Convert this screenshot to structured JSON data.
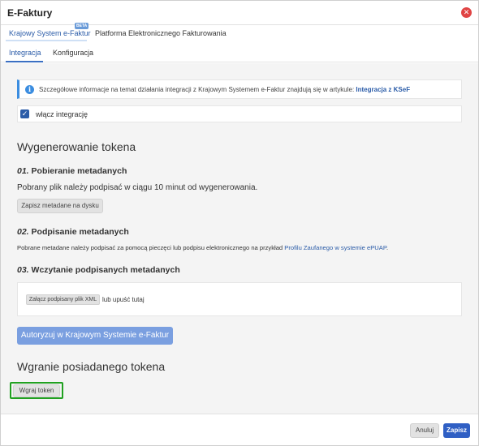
{
  "window": {
    "title": "E-Faktury",
    "close_icon": "close-icon"
  },
  "tabs_primary": [
    {
      "label": "Krajowy System e-Faktur",
      "badge": "BETA",
      "active": true
    },
    {
      "label": "Platforma Elektronicznego Fakturowania",
      "active": false
    }
  ],
  "tabs_secondary": [
    {
      "label": "Integracja",
      "active": true
    },
    {
      "label": "Konfiguracja",
      "active": false
    }
  ],
  "info": {
    "text": "Szczegółowe informacje na temat działania integracji z Krajowym Systemem e-Faktur znajdują się w artykule: ",
    "link": "Integracja z KSeF"
  },
  "enable": {
    "label": "włącz integrację",
    "checked": true
  },
  "generate": {
    "title": "Wygenerowanie tokena",
    "step1": {
      "num": "01.",
      "title": "Pobieranie metadanych",
      "desc": "Pobrany plik należy podpisać w ciągu 10 minut od wygenerowania.",
      "button": "Zapisz metadane na dysku"
    },
    "step2": {
      "num": "02.",
      "title": "Podpisanie metadanych",
      "desc": "Pobrane metadane należy podpisać za pomocą pieczęci lub podpisu elektronicznego na przykład ",
      "link": "Profilu Zaufanego w systemie ePUAP",
      "desc_end": "."
    },
    "step3": {
      "num": "03.",
      "title": "Wczytanie podpisanych metadanych",
      "attach_button": "Załącz podpisany plik XML",
      "drop_text": "lub upuść tutaj"
    },
    "authorize_button": "Autoryzuj w Krajowym Systemie e-Faktur"
  },
  "upload": {
    "title": "Wgranie posiadanego tokena",
    "button": "Wgraj token"
  },
  "footer": {
    "cancel": "Anuluj",
    "save": "Zapisz"
  },
  "colors": {
    "accent": "#2b5ca8",
    "primary_button": "#2f5fc4",
    "disabled_button": "#7a9fe0",
    "info_border": "#3b8de0",
    "highlight_frame": "#21a121",
    "close": "#e04444"
  }
}
